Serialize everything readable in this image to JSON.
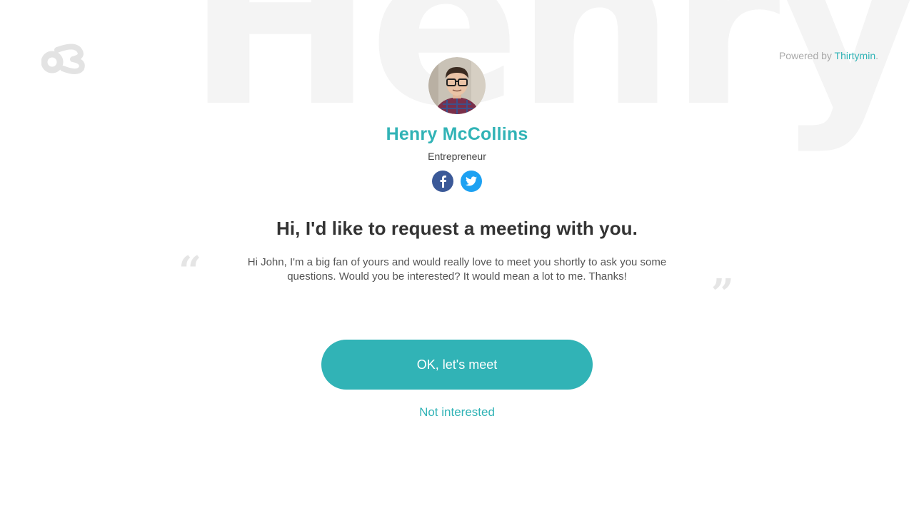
{
  "background": {
    "name_text": "Henry"
  },
  "header": {
    "powered_prefix": "Powered by",
    "powered_link": "Thirtymin",
    "powered_suffix": "."
  },
  "profile": {
    "name": "Henry McCollins",
    "role": "Entrepreneur"
  },
  "socials": [
    {
      "icon": "facebook-icon",
      "color": "#3b5998"
    },
    {
      "icon": "twitter-icon",
      "color": "#1da1f2"
    }
  ],
  "request": {
    "heading": "Hi, I'd like to request a meeting with you.",
    "message": "Hi John, I'm a big fan of yours and would really love to meet you shortly to ask you some questions. Would you be interested? It would mean a lot to me. Thanks!"
  },
  "actions": {
    "accept_label": "OK, let's meet",
    "decline_label": "Not interested"
  },
  "colors": {
    "accent": "#31b3b6",
    "text": "#333333"
  }
}
